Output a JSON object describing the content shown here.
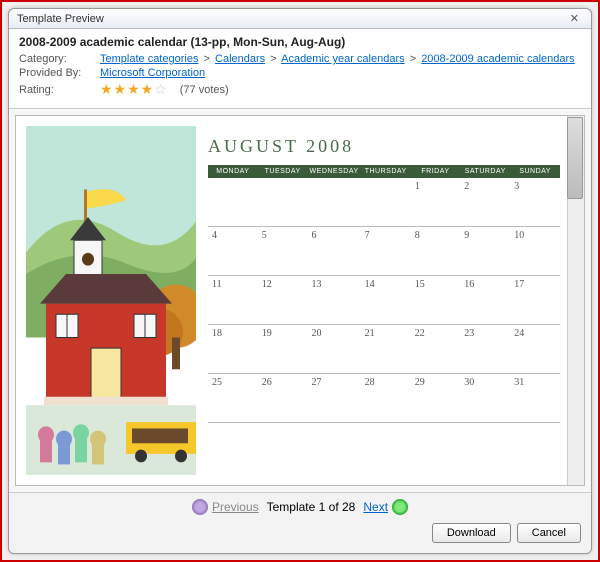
{
  "dialog": {
    "title": "Template Preview"
  },
  "template": {
    "name": "2008-2009 academic calendar (13-pp, Mon-Sun, Aug-Aug)",
    "category_label": "Category:",
    "breadcrumbs": [
      "Template categories",
      "Calendars",
      "Academic year calendars",
      "2008-2009 academic calendars"
    ],
    "provided_label": "Provided By:",
    "provider": "Microsoft Corporation",
    "rating_label": "Rating:",
    "rating_value": 4,
    "votes_text": "(77 votes)"
  },
  "calendar": {
    "month_title": "AUGUST 2008",
    "days": [
      "MONDAY",
      "TUESDAY",
      "WEDNESDAY",
      "THURSDAY",
      "FRIDAY",
      "SATURDAY",
      "SUNDAY"
    ],
    "rows": [
      [
        "",
        "",
        "",
        "",
        "1",
        "2",
        "3"
      ],
      [
        "4",
        "5",
        "6",
        "7",
        "8",
        "9",
        "10"
      ],
      [
        "11",
        "12",
        "13",
        "14",
        "15",
        "16",
        "17"
      ],
      [
        "18",
        "19",
        "20",
        "21",
        "22",
        "23",
        "24"
      ],
      [
        "25",
        "26",
        "27",
        "28",
        "29",
        "30",
        "31"
      ]
    ]
  },
  "nav": {
    "previous": "Previous",
    "position": "Template 1 of 28",
    "next": "Next"
  },
  "buttons": {
    "download": "Download",
    "cancel": "Cancel"
  }
}
